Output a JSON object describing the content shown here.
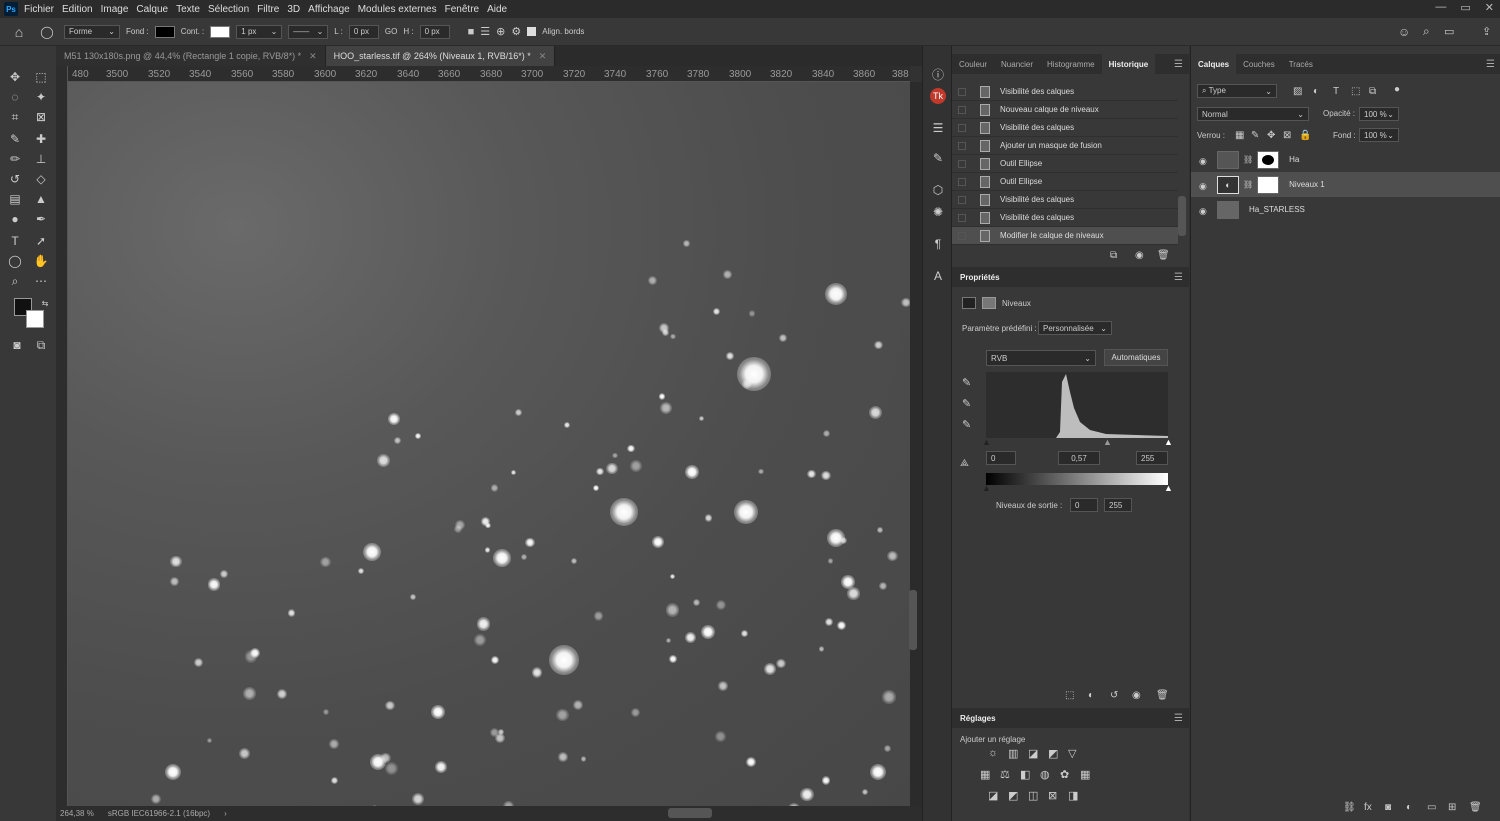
{
  "menu": {
    "logo": "Ps",
    "items": [
      "Fichier",
      "Edition",
      "Image",
      "Calque",
      "Texte",
      "Sélection",
      "Filtre",
      "3D",
      "Affichage",
      "Modules externes",
      "Fenêtre",
      "Aide"
    ]
  },
  "window_controls": [
    "—",
    "▭",
    "✕"
  ],
  "options": {
    "shape_mode": "Forme",
    "fill_label": "Fond :",
    "stroke_label": "Cont. :",
    "stroke_width": "1 px",
    "w_label": "L :",
    "w_value": "0 px",
    "link_icon": "GO",
    "h_label": "H :",
    "h_value": "0 px",
    "align_label": "Align. bords"
  },
  "tabs": [
    {
      "label": "M51 130x180s.png @ 44,4% (Rectangle 1 copie, RVB/8*) *",
      "close": "✕"
    },
    {
      "label": "HOO_starless.tif @ 264% (Niveaux 1, RVB/16*) *",
      "close": "✕"
    }
  ],
  "ruler_top": [
    "480",
    "3500",
    "3520",
    "3540",
    "3560",
    "3580",
    "3600",
    "3620",
    "3640",
    "3660",
    "3680",
    "3700",
    "3720",
    "3740",
    "3760",
    "3780",
    "3800",
    "3820",
    "3840",
    "3860",
    "388"
  ],
  "status": {
    "zoom": "264,38 %",
    "profile": "sRGB IEC61966-2.1 (16bpc)",
    "arrow": "›"
  },
  "history": {
    "tabs": [
      "Couleur",
      "Nuancier",
      "Histogramme",
      "Historique"
    ],
    "items": [
      "Visibilité des calques",
      "Nouveau calque de niveaux",
      "Visibilité des calques",
      "Ajouter un masque de fusion",
      "Outil Ellipse",
      "Outil Ellipse",
      "Visibilité des calques",
      "Visibilité des calques",
      "Modifier le calque de niveaux"
    ]
  },
  "properties": {
    "title": "Propriétés",
    "adj_name": "Niveaux",
    "preset_label": "Paramètre prédéfini :",
    "preset_value": "Personnalisée",
    "channel": "RVB",
    "auto_button": "Automatiques",
    "input_black": "0",
    "input_gamma": "0,57",
    "input_white": "255",
    "output_label": "Niveaux de sortie :",
    "output_black": "0",
    "output_white": "255"
  },
  "adjustments": {
    "title": "Réglages",
    "add_label": "Ajouter un réglage"
  },
  "layers": {
    "tabs": [
      "Calques",
      "Couches",
      "Tracés"
    ],
    "filter": "Type",
    "blend_mode": "Normal",
    "opacity_label": "Opacité :",
    "opacity_value": "100 %",
    "lock_label": "Verrou :",
    "fill_label": "Fond :",
    "fill_value": "100 %",
    "items": [
      {
        "name": "Ha",
        "visible": true
      },
      {
        "name": "Niveaux 1",
        "visible": true,
        "selected": true
      },
      {
        "name": "Ha_STARLESS",
        "visible": true
      }
    ]
  },
  "colors": {
    "accent": "#31a8ff",
    "panel": "#383838",
    "dark": "#2b2b2b"
  }
}
